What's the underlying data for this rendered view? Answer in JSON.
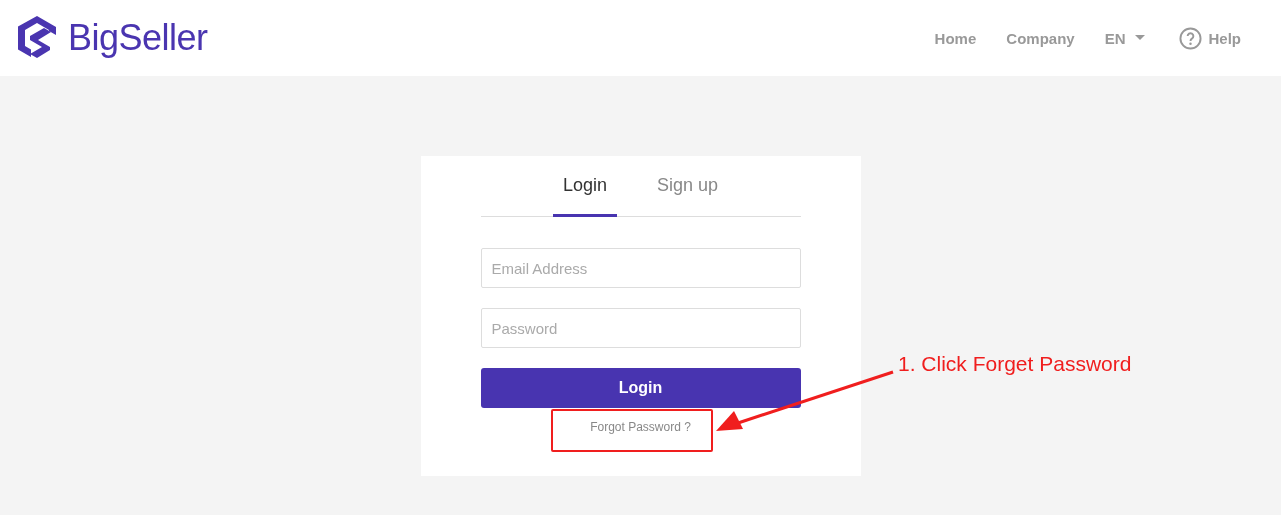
{
  "brand": {
    "name": "BigSeller"
  },
  "nav": [
    {
      "label": "Home",
      "kind": "link"
    },
    {
      "label": "Company",
      "kind": "link"
    },
    {
      "label": "EN",
      "kind": "dropdown"
    },
    {
      "label": "Help",
      "kind": "help"
    }
  ],
  "tabs": [
    {
      "label": "Login",
      "selected": true
    },
    {
      "label": "Sign up",
      "selected": false
    }
  ],
  "fields": [
    {
      "placeholder": "Email Address"
    },
    {
      "placeholder": "Password"
    }
  ],
  "submit": "Login",
  "forgot_link": "Forgot Password ?",
  "annotation": {
    "text": "1. Click Forget Password"
  }
}
